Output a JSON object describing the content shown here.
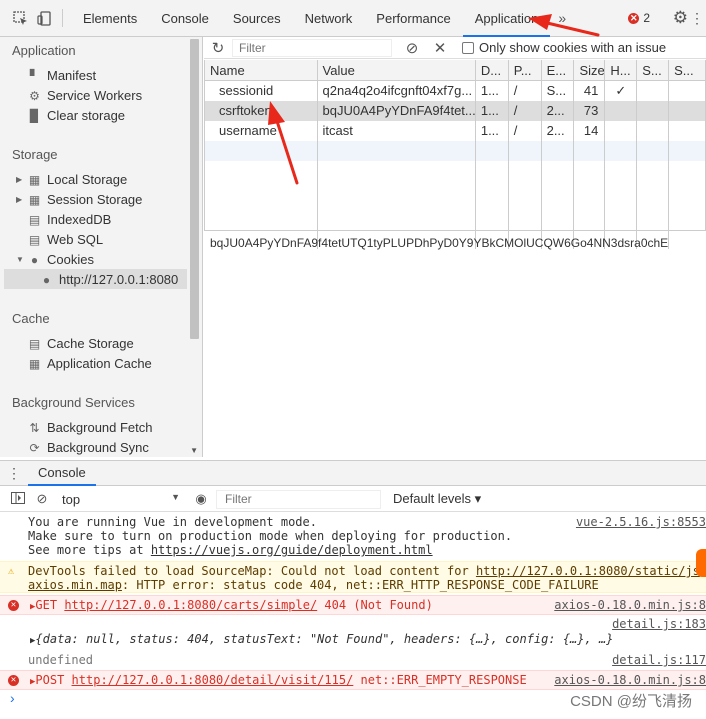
{
  "topbar": {
    "tabs": [
      "Elements",
      "Console",
      "Sources",
      "Network",
      "Performance",
      "Application"
    ],
    "active_tab": "Application",
    "more": "»",
    "error_count": "2"
  },
  "sidebar": {
    "application_header": "Application",
    "application_items": [
      "Manifest",
      "Service Workers",
      "Clear storage"
    ],
    "storage_header": "Storage",
    "storage_items": [
      "Local Storage",
      "Session Storage",
      "IndexedDB",
      "Web SQL",
      "Cookies"
    ],
    "cookie_origin": "http://127.0.0.1:8080",
    "cache_header": "Cache",
    "cache_items": [
      "Cache Storage",
      "Application Cache"
    ],
    "bg_header": "Background Services",
    "bg_items": [
      "Background Fetch",
      "Background Sync"
    ]
  },
  "cookie_toolbar": {
    "filter_placeholder": "Filter",
    "only_issue_label": "Only show cookies with an issue"
  },
  "cookie_table": {
    "columns": [
      "Name",
      "Value",
      "D...",
      "P...",
      "E...",
      "Size",
      "H...",
      "S...",
      "S..."
    ],
    "rows": [
      {
        "name": "sessionid",
        "value": "q2na4q2o4ifcgnft04xf7g...",
        "domain": "1...",
        "path": "/",
        "expires": "S...",
        "size": "41",
        "httponly": "✓",
        "secure": "",
        "samesite": ""
      },
      {
        "name": "csrftoken",
        "value": "bqJU0A4PyYDnFA9f4tet...",
        "domain": "1...",
        "path": "/",
        "expires": "2...",
        "size": "73",
        "httponly": "",
        "secure": "",
        "samesite": ""
      },
      {
        "name": "username",
        "value": "itcast",
        "domain": "1...",
        "path": "/",
        "expires": "2...",
        "size": "14",
        "httponly": "",
        "secure": "",
        "samesite": ""
      }
    ],
    "selected_value": "bqJU0A4PyYDnFA9f4tetUTQ1tyPLUPDhPyD0Y9YBkCMOlUCQW6Go4NN3dsra0chE"
  },
  "drawer": {
    "tab": "Console"
  },
  "console_toolbar": {
    "context": "top",
    "filter_placeholder": "Filter",
    "levels": "Default levels ▾"
  },
  "console": {
    "vue_lines": [
      "You are running Vue in development mode.",
      "Make sure to turn on production mode when deploying for production.",
      "See more tips at "
    ],
    "vue_link": "https://vuejs.org/guide/deployment.html",
    "vue_src": "vue-2.5.16.js:8553",
    "warn_line1": "DevTools failed to load SourceMap: Could not load content for ",
    "warn_link1": "http://127.0.0.1:8080/static/js",
    "warn_link2": "axios.min.map",
    "warn_line2": ": HTTP error: status code 404, net::ERR_HTTP_RESPONSE_CODE_FAILURE",
    "err1_method": "GET ",
    "err1_url": "http://127.0.0.1:8080/carts/simple/",
    "err1_status": " 404 (Not Found)",
    "err1_src": "axios-0.18.0.min.js:8",
    "obj_src": "detail.js:183",
    "obj_text": "{data: null, status: 404, statusText: \"Not Found\", headers: {…}, config: {…}, …}",
    "undefined_text": "undefined",
    "undefined_src": "detail.js:117",
    "err2_method": "POST ",
    "err2_url": "http://127.0.0.1:8080/detail/visit/115/",
    "err2_status": " net::ERR_EMPTY_RESPONSE",
    "err2_src": "axios-0.18.0.min.js:8",
    "prompt": "›"
  },
  "watermark": "CSDN @纷飞清扬"
}
